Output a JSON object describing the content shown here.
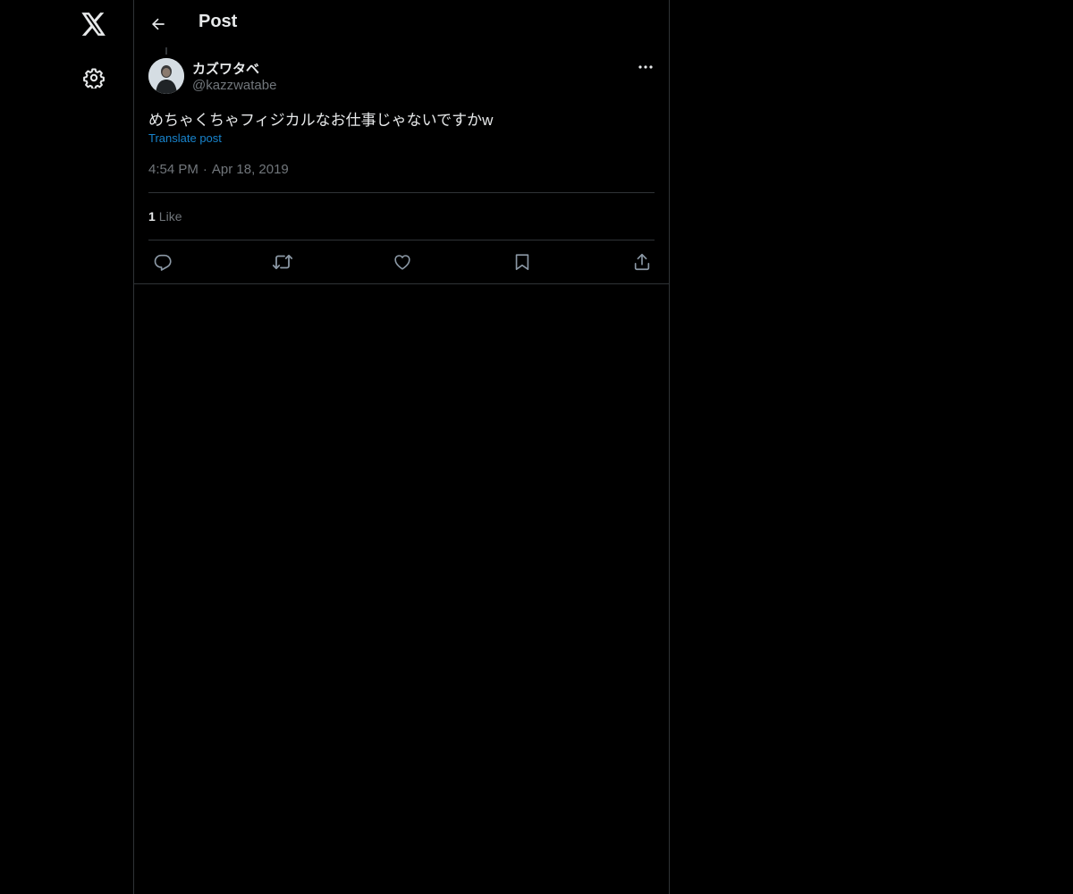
{
  "header": {
    "title": "Post"
  },
  "post": {
    "author": {
      "display_name": "カズワタベ",
      "handle": "@kazzwatabe"
    },
    "text": "めちゃくちゃフィジカルなお仕事じゃないですかw",
    "translate_label": "Translate post",
    "time": "4:54 PM",
    "separator": "·",
    "date": "Apr 18, 2019",
    "likes": {
      "count": "1",
      "label": "Like"
    }
  },
  "icons": {
    "logo": "x-logo-icon",
    "settings": "gear-icon",
    "back": "arrow-left-icon",
    "more": "more-dots-icon",
    "reply": "reply-icon",
    "repost": "repost-icon",
    "like": "heart-icon",
    "bookmark": "bookmark-icon",
    "share": "share-icon"
  },
  "colors": {
    "background": "#000000",
    "text": "#e7e9ea",
    "muted": "#71767b",
    "border": "#2f3336",
    "link": "#1d9bf0"
  }
}
